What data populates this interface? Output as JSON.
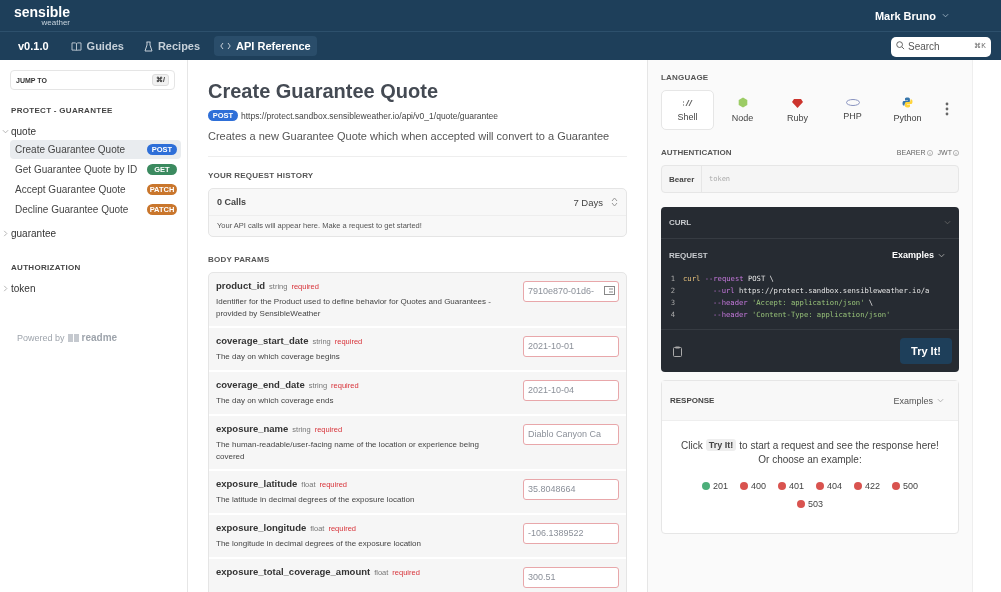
{
  "header": {
    "logo_main": "sensible",
    "logo_sub": "weather",
    "user": "Mark Bruno"
  },
  "nav": {
    "version": "v0.1.0",
    "items": [
      {
        "kind": "book",
        "label": "Guides",
        "selected": false
      },
      {
        "kind": "flask",
        "label": "Recipes",
        "selected": false
      },
      {
        "kind": "code",
        "label": "API Reference",
        "selected": true
      }
    ],
    "search": {
      "placeholder": "Search",
      "shortcut": "⌘K"
    }
  },
  "sidebar": {
    "jump": {
      "label": "JUMP TO",
      "shortcut": "⌘/"
    },
    "sections": [
      {
        "title": "PROTECT - GUARANTEE",
        "groups": [
          {
            "label": "quote",
            "expanded": true,
            "children": [
              {
                "label": "Create Guarantee Quote",
                "method": "POST",
                "color": "#2e6fd8",
                "selected": true
              },
              {
                "label": "Get Guarantee Quote by ID",
                "method": "GET",
                "color": "#3b8a5f",
                "selected": false
              },
              {
                "label": "Accept Guarantee Quote",
                "method": "PATCH",
                "color": "#c9762c",
                "selected": false
              },
              {
                "label": "Decline Guarantee Quote",
                "method": "PATCH",
                "color": "#c9762c",
                "selected": false
              }
            ]
          },
          {
            "label": "guarantee",
            "expanded": false
          }
        ]
      },
      {
        "title": "AUTHORIZATION",
        "groups": [
          {
            "label": "token",
            "expanded": false
          }
        ]
      }
    ],
    "powered_by": "Powered by",
    "powered_brand": "readme"
  },
  "main": {
    "title": "Create Guarantee Quote",
    "method": "POST",
    "url": "https://protect.sandbox.sensibleweather.io/api/v0_1/quote/guarantee",
    "description": "Creates a new Guarantee Quote which when accepted will convert to a Guarantee",
    "history": {
      "heading": "YOUR REQUEST HISTORY",
      "calls": "0 Calls",
      "range": "7 Days",
      "note": "Your API calls will appear here. Make a request to get started!"
    },
    "params_heading": "BODY PARAMS",
    "params": [
      {
        "name": "product_id",
        "type": "string",
        "required": "required",
        "description": "Identifier for the Product used to define behavior for Quotes and Guarantees - provided by SensibleWeather",
        "placeholder": "7910e870-01d6-",
        "has_icon": true
      },
      {
        "name": "coverage_start_date",
        "type": "string",
        "required": "required",
        "description": "The day on which coverage begins",
        "placeholder": "2021-10-01",
        "has_icon": false
      },
      {
        "name": "coverage_end_date",
        "type": "string",
        "required": "required",
        "description": "The day on which coverage ends",
        "placeholder": "2021-10-04",
        "has_icon": false
      },
      {
        "name": "exposure_name",
        "type": "string",
        "required": "required",
        "description": "The human-readable/user-facing name of the location or experience being covered",
        "placeholder": "Diablo Canyon Ca",
        "has_icon": false
      },
      {
        "name": "exposure_latitude",
        "type": "float",
        "required": "required",
        "description": "The latitude in decimal degrees of the exposure location",
        "placeholder": "35.8048664",
        "has_icon": false
      },
      {
        "name": "exposure_longitude",
        "type": "float",
        "required": "required",
        "description": "The longitude in decimal degrees of the exposure location",
        "placeholder": "-106.1389522",
        "has_icon": false
      },
      {
        "name": "exposure_total_coverage_amount",
        "type": "float",
        "required": "required",
        "placeholder": "300.51",
        "has_icon": false
      }
    ]
  },
  "right": {
    "language_heading": "LANGUAGE",
    "languages": [
      {
        "kind": "shell",
        "label": "Shell",
        "selected": true
      },
      {
        "kind": "node",
        "label": "Node",
        "selected": false
      },
      {
        "kind": "ruby",
        "label": "Ruby",
        "selected": false
      },
      {
        "kind": "php",
        "label": "PHP",
        "selected": false
      },
      {
        "kind": "python",
        "label": "Python",
        "selected": false
      }
    ],
    "auth_heading": "AUTHENTICATION",
    "auth_types": [
      "BEARER",
      "JWT"
    ],
    "auth_label": "Bearer",
    "auth_placeholder": "token",
    "code": {
      "title": "CURL",
      "request": "REQUEST",
      "examples": "Examples",
      "lines": [
        {
          "num": "1",
          "segments": [
            {
              "kind": "cmd",
              "text": "curl"
            },
            {
              "kind": "flag",
              "text": " --request"
            },
            {
              "kind": "plain",
              "text": " POST \\"
            }
          ]
        },
        {
          "num": "2",
          "indent": true,
          "segments": [
            {
              "kind": "flag",
              "text": "--url"
            },
            {
              "kind": "plain",
              "text": " https://protect.sandbox.sensibleweather.io/a"
            }
          ]
        },
        {
          "num": "3",
          "indent": true,
          "segments": [
            {
              "kind": "flag",
              "text": "--header"
            },
            {
              "kind": "string",
              "text": " 'Accept: application/json'"
            },
            {
              "kind": "plain",
              "text": " \\"
            }
          ]
        },
        {
          "num": "4",
          "indent": true,
          "segments": [
            {
              "kind": "flag",
              "text": "--header"
            },
            {
              "kind": "string",
              "text": " 'Content-Type: application/json'"
            }
          ]
        }
      ],
      "try": "Try It!"
    },
    "response": {
      "title": "RESPONSE",
      "examples": "Examples",
      "click": "Click",
      "try": "Try It!",
      "rest": "to start a request and see the response here!",
      "or": "Or choose an example:",
      "codes": [
        {
          "code": "201",
          "color": "#4caf7a"
        },
        {
          "code": "400",
          "color": "#d9534f"
        },
        {
          "code": "401",
          "color": "#d9534f"
        },
        {
          "code": "404",
          "color": "#d9534f"
        },
        {
          "code": "422",
          "color": "#d9534f"
        },
        {
          "code": "500",
          "color": "#d9534f"
        },
        {
          "code": "503",
          "color": "#d9534f"
        }
      ]
    }
  }
}
